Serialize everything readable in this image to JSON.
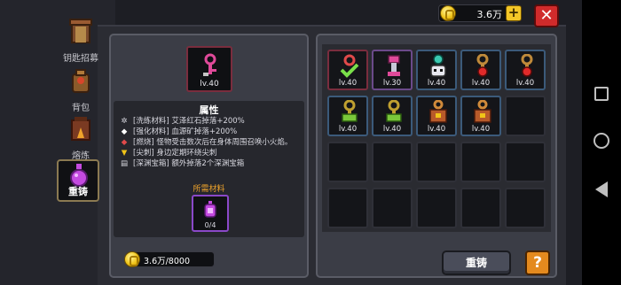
{
  "sidebar": {
    "items": [
      {
        "label": "钥匙招募",
        "icon": "gate-icon",
        "active": false
      },
      {
        "label": "背包",
        "icon": "backpack-icon",
        "active": false
      },
      {
        "label": "熔炼",
        "icon": "furnace-icon",
        "active": false
      },
      {
        "label": "重铸",
        "icon": "reforge-potion-icon",
        "active": true
      }
    ]
  },
  "header": {
    "coins": "3.6万",
    "plus_label": "+",
    "close_label": "✕"
  },
  "detail": {
    "item_level": "lv.40",
    "attr_title": "属性",
    "attributes": [
      {
        "bullet": "✲",
        "text": "[洗练材料] 艾泽红石掉落+200%"
      },
      {
        "bullet": "◆",
        "text": "[强化材料] 血源矿掉落+200%"
      },
      {
        "bullet": "◆",
        "text": "[燃烧] 怪物受击数次后在身体周围召唤小火焰。"
      },
      {
        "bullet": "▼",
        "text": "[尖刺] 身边定期环绕尖刺"
      },
      {
        "bullet": "▤",
        "text": "[深渊宝箱] 额外掉落2个深渊宝箱"
      }
    ],
    "required_title": "所需材料",
    "required_count": "0/4",
    "cost": "3.6万/8000"
  },
  "grid": {
    "items": [
      {
        "level": "lv.40",
        "icon": "check-key-icon",
        "frame": "sel"
      },
      {
        "level": "lv.30",
        "icon": "pink-key-icon",
        "frame": "purple"
      },
      {
        "level": "lv.40",
        "icon": "teal-skull-key-icon",
        "frame": "filled"
      },
      {
        "level": "lv.40",
        "icon": "red-gem-key-icon",
        "frame": "filled"
      },
      {
        "level": "lv.40",
        "icon": "red-gem-key-icon",
        "frame": "filled"
      },
      {
        "level": "lv.40",
        "icon": "green-key-icon",
        "frame": "filled"
      },
      {
        "level": "lv.40",
        "icon": "green-key-icon",
        "frame": "filled"
      },
      {
        "level": "lv.40",
        "icon": "orange-chest-key-icon",
        "frame": "filled"
      },
      {
        "level": "lv.40",
        "icon": "orange-chest-key-icon",
        "frame": "filled"
      }
    ]
  },
  "actions": {
    "reforge_label": "重铸",
    "help_label": "?"
  },
  "colors": {
    "accent_gold": "#f3c627",
    "close_red": "#d02b2b",
    "required_orange": "#f0a42b",
    "rare_purple": "#8a48c8"
  }
}
